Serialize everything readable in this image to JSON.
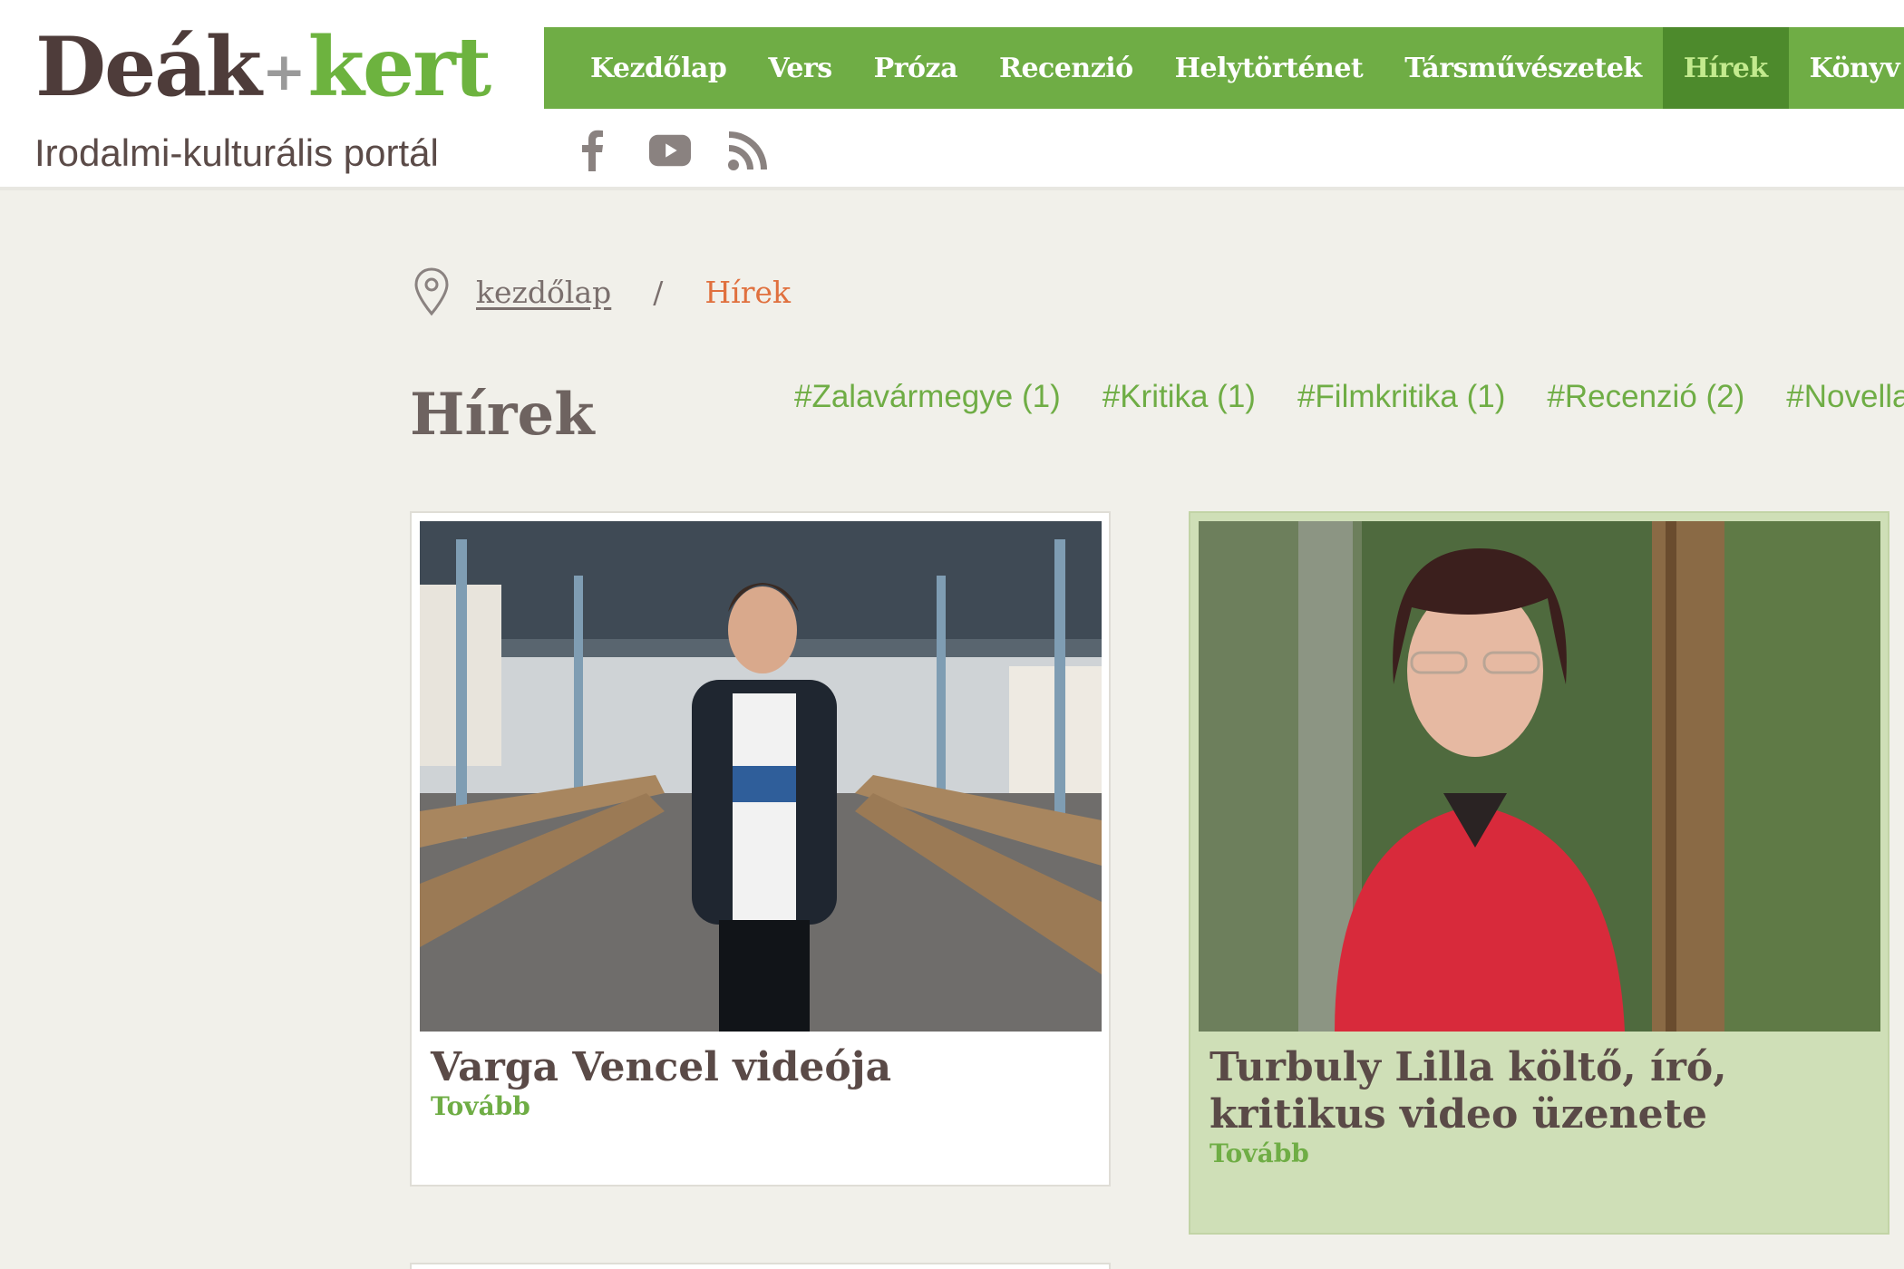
{
  "site": {
    "logo_part1": "Deák",
    "logo_plus": "+",
    "logo_part2": "kert",
    "tagline": "Irodalmi-kulturális portál"
  },
  "nav": {
    "items": [
      {
        "label": "Kezdőlap"
      },
      {
        "label": "Vers"
      },
      {
        "label": "Próza"
      },
      {
        "label": "Recenzió"
      },
      {
        "label": "Helytörténet"
      },
      {
        "label": "Társművészetek"
      },
      {
        "label": "Hírek",
        "active": true
      },
      {
        "label": "Könyv"
      }
    ]
  },
  "social": {
    "icons": [
      "facebook-icon",
      "youtube-icon",
      "rss-icon"
    ]
  },
  "breadcrumb": {
    "home": "kezdőlap",
    "separator": "/",
    "current": "Hírek"
  },
  "page": {
    "title": "Hírek"
  },
  "tags": [
    {
      "label": "#Zalavármegye (1)"
    },
    {
      "label": "#Kritika (1)"
    },
    {
      "label": "#Filmkritika (1)"
    },
    {
      "label": "#Recenzió (2)"
    },
    {
      "label": "#Novella"
    }
  ],
  "cards": [
    {
      "title": "Varga Vencel videója",
      "more": "Tovább"
    },
    {
      "title": "Turbuly Lilla költő, író, kritikus video üzenete",
      "more": "Tovább"
    }
  ],
  "colors": {
    "nav_green": "#6fad45",
    "nav_active": "#4d8a2c",
    "brand_brown": "#4e3c3a",
    "breadcrumb_current": "#e0703e",
    "highlight_card": "#cfdfb7"
  }
}
